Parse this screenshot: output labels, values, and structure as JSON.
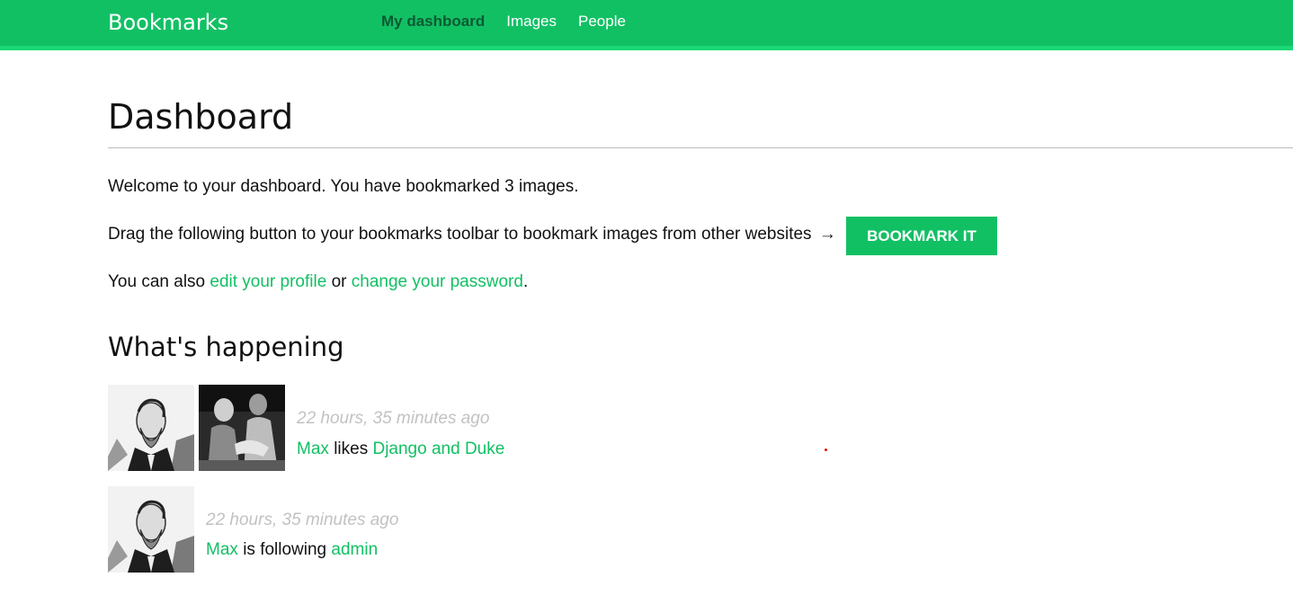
{
  "header": {
    "logo": "Bookmarks",
    "menu": [
      {
        "label": "My dashboard",
        "selected": true
      },
      {
        "label": "Images",
        "selected": false
      },
      {
        "label": "People",
        "selected": false
      }
    ],
    "colors": {
      "bar": "#12c064",
      "bar_border": "#19d875",
      "selected_text": "#0b5a32"
    }
  },
  "main": {
    "title": "Dashboard",
    "welcome": "Welcome to your dashboard. You have bookmarked 3 images.",
    "drag_text": "Drag the following button to your bookmarks toolbar to bookmark images from other websites",
    "drag_arrow": "→",
    "bookmarklet_label": "BOOKMARK IT",
    "also_prefix": "You can also",
    "edit_profile_link": "edit your profile",
    "also_or": "or",
    "change_password_link": "change your password",
    "also_suffix": "."
  },
  "activity": {
    "title": "What's happening",
    "actions": [
      {
        "time": "22 hours, 35 minutes ago",
        "user": "Max",
        "verb": "likes",
        "target": "Django and Duke",
        "images": [
          "user-avatar-portrait",
          "django-and-duke-photo"
        ]
      },
      {
        "time": "22 hours, 35 minutes ago",
        "user": "Max",
        "verb": "is following",
        "target": "admin",
        "images": [
          "user-avatar-portrait"
        ]
      }
    ]
  },
  "colors": {
    "accent": "#12c064",
    "muted": "#c2c2c2",
    "text": "#111111"
  }
}
